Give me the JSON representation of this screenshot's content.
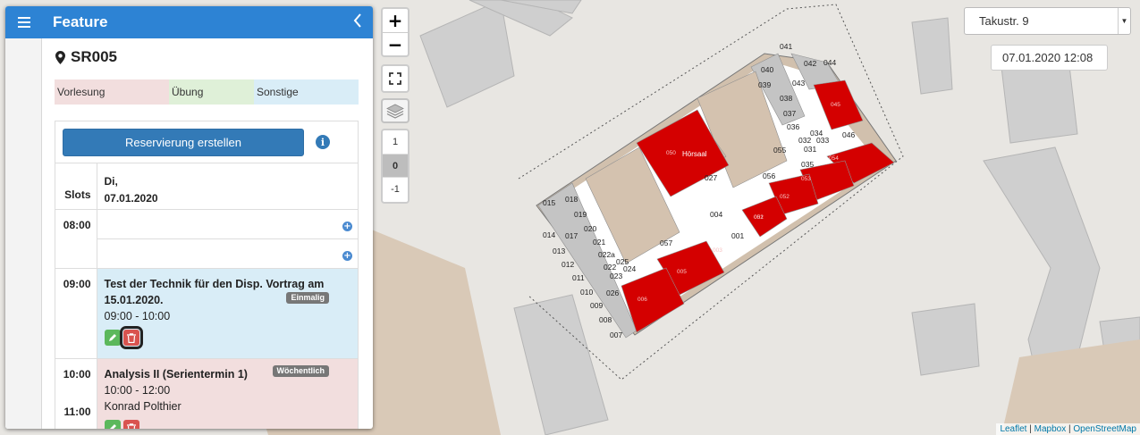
{
  "sidebar": {
    "title": "Feature",
    "room": "SR005",
    "legend": {
      "lecture": "Vorlesung",
      "exercise": "Übung",
      "other": "Sonstige"
    },
    "reserve_button": "Reservierung erstellen",
    "slots_header": "Slots",
    "day_header_line1": "Di,",
    "day_header_line2": "07.01.2020",
    "times": {
      "t0800": "08:00",
      "t0900": "09:00",
      "t1000": "10:00",
      "t1100": "11:00"
    },
    "events": [
      {
        "title": "Test der Technik für den Disp. Vortrag am 15.01.2020.",
        "badge": "Einmalig",
        "time": "09:00 - 10:00",
        "type_color": "#d9edf7"
      },
      {
        "title": "Analysis II (Serientermin 1)",
        "badge": "Wöchentlich",
        "time": "10:00 - 12:00",
        "person": "Konrad Polthier",
        "type_color": "#f2dede"
      }
    ],
    "header_color": "#2d83d4"
  },
  "map_controls": {
    "zoom_in": "+",
    "zoom_out": "−",
    "levels": [
      "1",
      "0",
      "-1"
    ],
    "active_level": "0"
  },
  "building_select": {
    "value": "Takustr. 9"
  },
  "datetime": {
    "value": "07.01.2020 12:08"
  },
  "attribution": {
    "leaflet": "Leaflet",
    "mapbox": "Mapbox",
    "osm": "OpenStreetMap",
    "sep": "|"
  },
  "rooms": {
    "hoersaal": "Hörsaal",
    "labels": [
      "040",
      "041",
      "042",
      "039",
      "043",
      "038",
      "044",
      "037",
      "036",
      "034",
      "032",
      "033",
      "031",
      "035",
      "046",
      "027",
      "056",
      "004",
      "001",
      "057",
      "018",
      "015",
      "019",
      "017",
      "014",
      "020",
      "013",
      "021",
      "022a",
      "012",
      "025",
      "022",
      "024",
      "011",
      "023",
      "010",
      "026",
      "009",
      "008",
      "007",
      "006",
      "005",
      "003",
      "002",
      "045",
      "054",
      "053",
      "052",
      "051",
      "050",
      "055"
    ]
  }
}
